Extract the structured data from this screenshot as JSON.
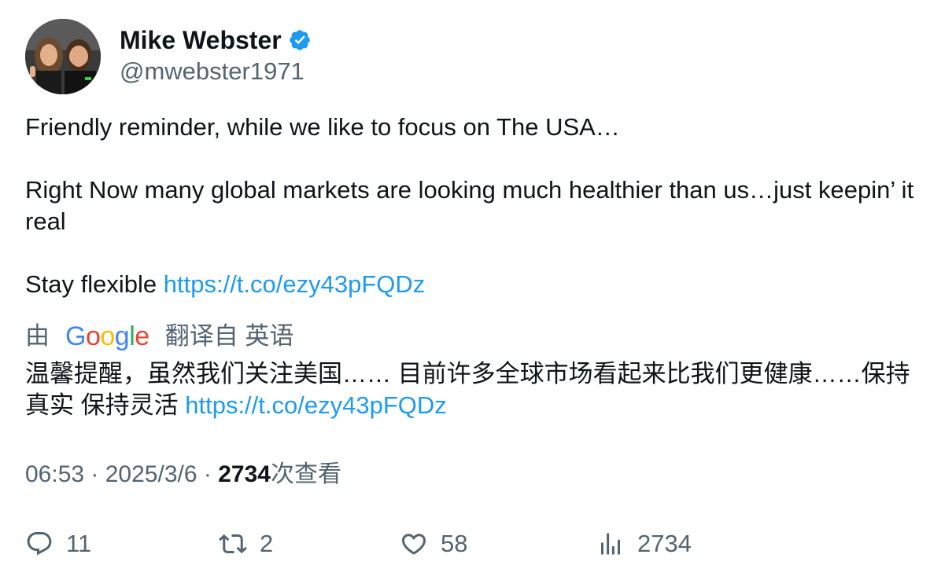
{
  "author": {
    "display_name": "Mike Webster",
    "handle": "@mwebster1971",
    "verified": true
  },
  "tweet": {
    "line1": "Friendly reminder, while we like to focus on The USA…",
    "line2": "Right Now many global markets are looking much healthier than us…just keepin’ it real",
    "line3_prefix": "Stay flexible ",
    "link": "https://t.co/ezy43pFQDz"
  },
  "translation": {
    "by_label": "由",
    "google_letters": [
      "G",
      "o",
      "o",
      "g",
      "l",
      "e"
    ],
    "from_label": "翻译自 英语",
    "text": "温馨提醒，虽然我们关注美国…… 目前许多全球市场看起来比我们更健康……保持真实 保持灵活 ",
    "link": "https://t.co/ezy43pFQDz"
  },
  "meta": {
    "time": "06:53",
    "sep1": " · ",
    "date": "2025/3/6",
    "sep2": " · ",
    "views_count": "2734",
    "views_label": "次查看"
  },
  "actions": {
    "replies": "11",
    "retweets": "2",
    "likes": "58",
    "views": "2734"
  },
  "colors": {
    "link": "#1d9bf0",
    "secondary_text": "#536471",
    "primary_text": "#0f1419",
    "verified": "#1d9bf0"
  }
}
